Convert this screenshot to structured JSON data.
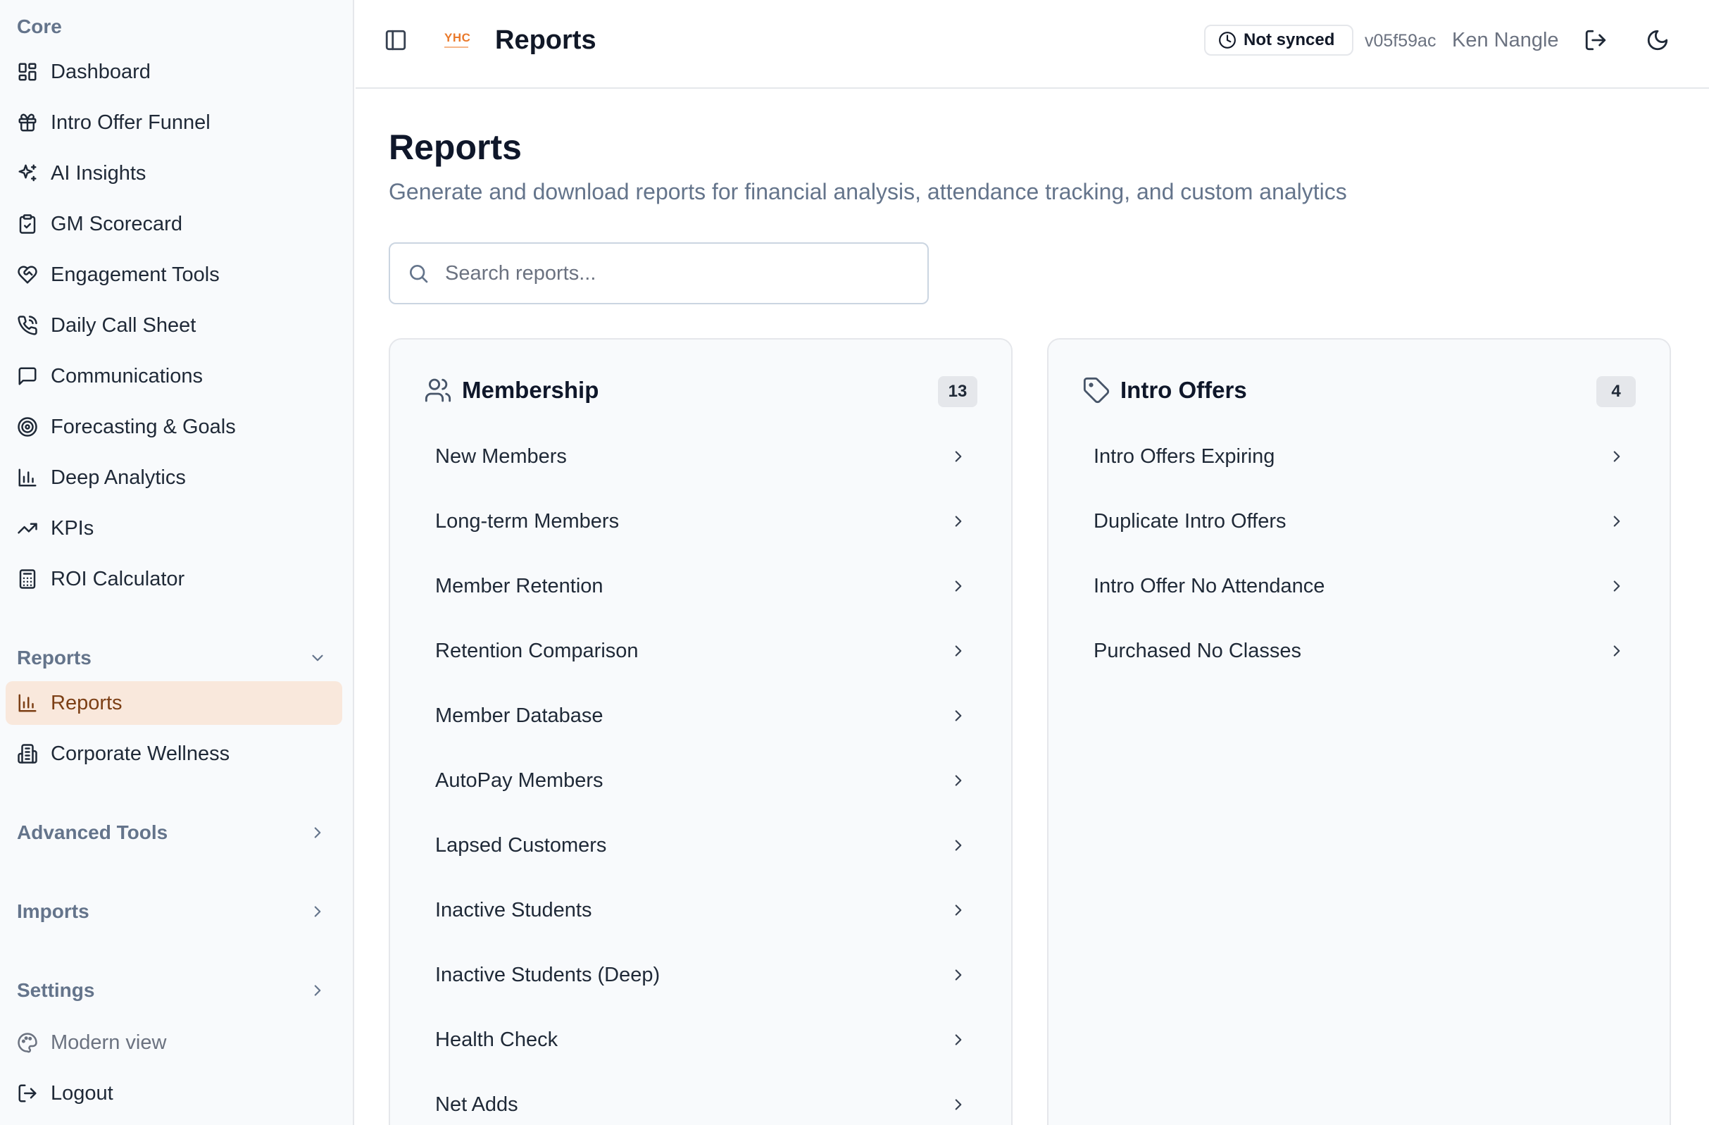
{
  "app": {
    "title": "Reports",
    "logo_text": "YHC"
  },
  "topbar": {
    "sync_status": "Not synced",
    "version": "v05f59ac",
    "user_name": "Ken Nangle"
  },
  "sidebar": {
    "core_label": "Core",
    "core_items": [
      {
        "label": "Dashboard",
        "icon": "dashboard-icon"
      },
      {
        "label": "Intro Offer Funnel",
        "icon": "gift-icon"
      },
      {
        "label": "AI Insights",
        "icon": "sparkles-icon"
      },
      {
        "label": "GM Scorecard",
        "icon": "clipboard-check-icon"
      },
      {
        "label": "Engagement Tools",
        "icon": "heart-handshake-icon"
      },
      {
        "label": "Daily Call Sheet",
        "icon": "phone-call-icon"
      },
      {
        "label": "Communications",
        "icon": "message-square-icon"
      },
      {
        "label": "Forecasting & Goals",
        "icon": "target-icon"
      },
      {
        "label": "Deep Analytics",
        "icon": "bar-chart-icon"
      },
      {
        "label": "KPIs",
        "icon": "trending-up-icon"
      },
      {
        "label": "ROI Calculator",
        "icon": "calculator-icon"
      }
    ],
    "reports_label": "Reports",
    "reports_items": [
      {
        "label": "Reports",
        "icon": "bar-chart-icon",
        "active": true
      },
      {
        "label": "Corporate Wellness",
        "icon": "building-icon"
      }
    ],
    "advanced_label": "Advanced Tools",
    "imports_label": "Imports",
    "settings_label": "Settings",
    "modern_view_label": "Modern view",
    "logout_label": "Logout"
  },
  "main": {
    "title": "Reports",
    "subtitle": "Generate and download reports for financial analysis, attendance tracking, and custom analytics",
    "search_placeholder": "Search reports..."
  },
  "cards": {
    "membership": {
      "title": "Membership",
      "count": "13",
      "icon": "users-icon",
      "items": [
        "New Members",
        "Long-term Members",
        "Member Retention",
        "Retention Comparison",
        "Member Database",
        "AutoPay Members",
        "Lapsed Customers",
        "Inactive Students",
        "Inactive Students (Deep)",
        "Health Check",
        "Net Adds"
      ]
    },
    "intro": {
      "title": "Intro Offers",
      "count": "4",
      "icon": "tag-icon",
      "items": [
        "Intro Offers Expiring",
        "Duplicate Intro Offers",
        "Intro Offer No Attendance",
        "Purchased No Classes"
      ]
    }
  },
  "colors": {
    "accent_bg": "#f9e8dc",
    "accent_text": "#7c3f15",
    "logo": "#ea7a2c"
  }
}
